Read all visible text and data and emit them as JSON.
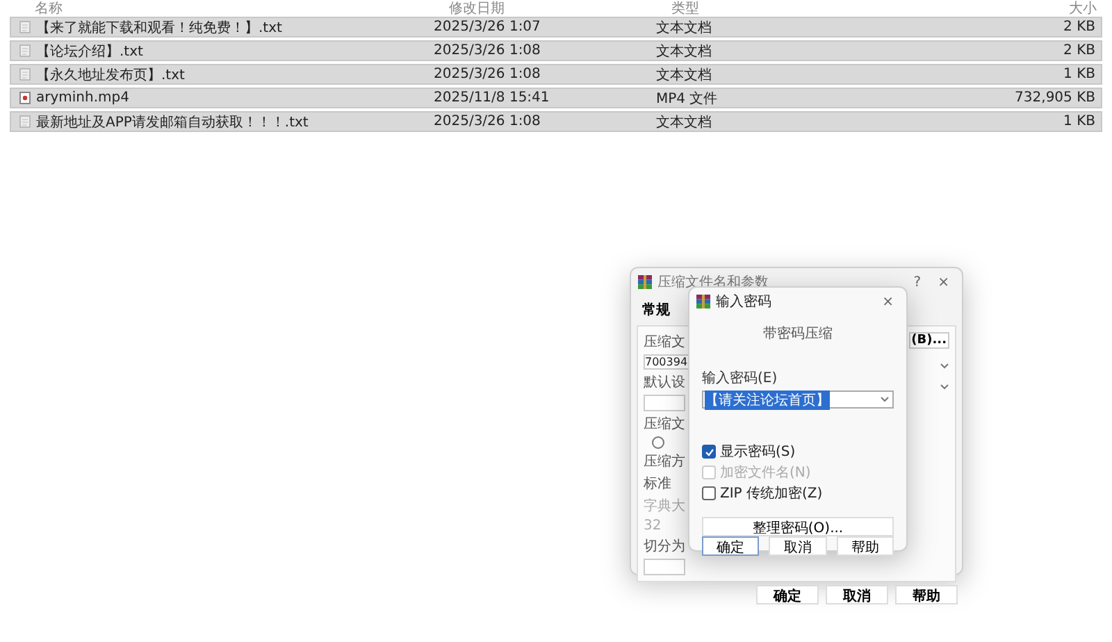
{
  "file_list": {
    "columns": [
      "名称",
      "修改日期",
      "类型",
      "大小"
    ],
    "rows": [
      {
        "name": "【来了就能下载和观看！纯免费！】.txt",
        "modified": "2025/3/26 1:07",
        "type": "文本文档",
        "size": "2 KB",
        "kind": "text",
        "selected": true
      },
      {
        "name": "【论坛介绍】.txt",
        "modified": "2025/3/26 1:08",
        "type": "文本文档",
        "size": "2 KB",
        "kind": "text",
        "selected": true
      },
      {
        "name": "【永久地址发布页】.txt",
        "modified": "2025/3/26 1:08",
        "type": "文本文档",
        "size": "1 KB",
        "kind": "text",
        "selected": true
      },
      {
        "name": "aryminh.mp4",
        "modified": "2025/11/8 15:41",
        "type": "MP4 文件",
        "size": "732,905 KB",
        "kind": "video",
        "selected": true
      },
      {
        "name": "最新地址及APP请发邮箱自动获取！！！.txt",
        "modified": "2025/3/26 1:08",
        "type": "文本文档",
        "size": "1 KB",
        "kind": "text",
        "selected": true
      }
    ]
  },
  "archive_dialog": {
    "title": "压缩文件名和参数",
    "help": "?",
    "close": "×",
    "tab": "常规",
    "fragments": [
      {
        "text": "压缩文",
        "kind": "label"
      },
      {
        "text": "700394",
        "kind": "field"
      },
      {
        "text": "默认设",
        "kind": "label"
      },
      {
        "kind": "box"
      },
      {
        "text": "压缩文",
        "kind": "label"
      },
      {
        "kind": "radio",
        "selected": false
      },
      {
        "text": "压缩方",
        "kind": "label"
      },
      {
        "text": "标准",
        "kind": "value"
      },
      {
        "text": "字典大",
        "kind": "disabled"
      },
      {
        "text": "32",
        "kind": "disabled"
      },
      {
        "text": "切分为",
        "kind": "label"
      },
      {
        "kind": "box"
      }
    ],
    "browse_button": "(B)...",
    "buttons": [
      "确定",
      "取消",
      "帮助"
    ]
  },
  "password_dialog": {
    "title": "输入密码",
    "close": "×",
    "heading": "带密码压缩",
    "field_label": "输入密码(E)",
    "password": "【请关注论坛首页】",
    "options": [
      {
        "label": "显示密码(S)",
        "checked": true,
        "disabled": false
      },
      {
        "label": "加密文件名(N)",
        "checked": false,
        "disabled": true
      },
      {
        "label": "ZIP 传统加密(Z)",
        "checked": false,
        "disabled": false
      }
    ],
    "organize_button": "整理密码(O)...",
    "buttons": [
      {
        "label": "确定",
        "selected": true
      },
      {
        "label": "取消",
        "selected": false
      },
      {
        "label": "帮助",
        "selected": false
      }
    ]
  }
}
